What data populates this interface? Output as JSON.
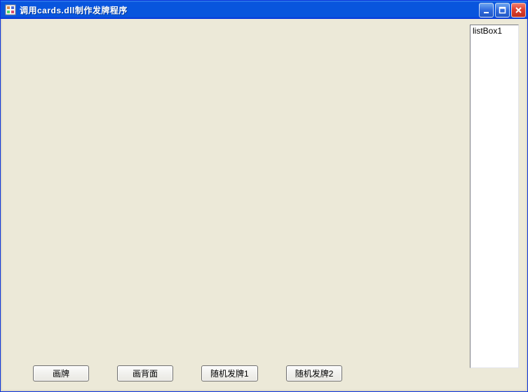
{
  "window": {
    "title": "调用cards.dll制作发牌程序"
  },
  "listbox": {
    "items": [
      "listBox1"
    ]
  },
  "buttons": {
    "draw_card": "画牌",
    "draw_back": "画背面",
    "random_deal_1": "随机发牌1",
    "random_deal_2": "随机发牌2"
  }
}
